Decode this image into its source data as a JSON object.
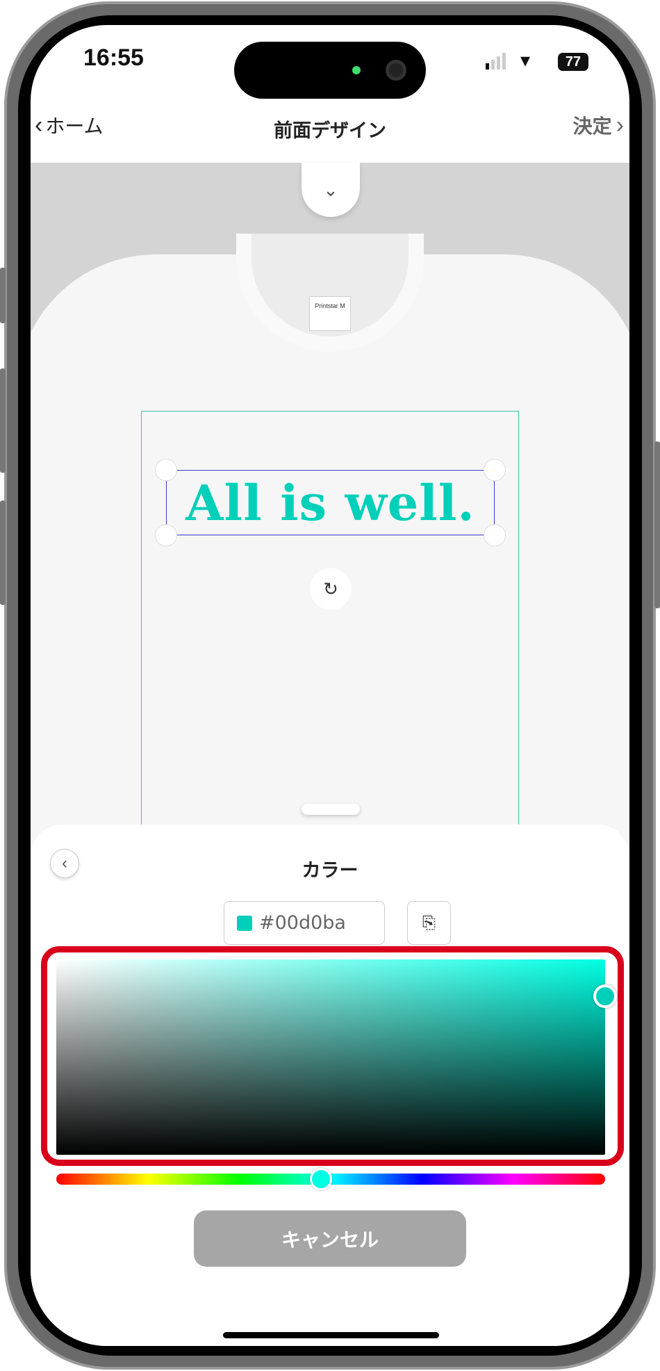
{
  "status_bar": {
    "time": "16:55",
    "battery": "77",
    "signal_icon": "signal-icon",
    "wifi_icon": "wifi-icon"
  },
  "nav": {
    "back_label": "ホーム",
    "title": "前面デザイン",
    "confirm_label": "決定"
  },
  "canvas": {
    "design_text": "All is well.",
    "design_color": "#00d0ba",
    "tag_text": "Printstar M"
  },
  "color_sheet": {
    "title": "カラー",
    "hex_value": "#00d0ba",
    "cancel_label": "キャンセル",
    "highlight_color": "#d9001b"
  },
  "picker": {
    "saturation": 1.0,
    "brightness": 0.82,
    "hue_degrees": 174
  }
}
